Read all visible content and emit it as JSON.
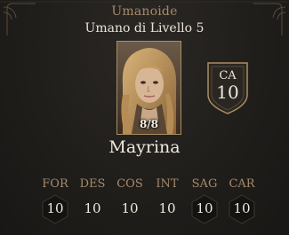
{
  "character": {
    "race": "Umanoide",
    "subrace": "Umano di Livello 5",
    "name": "Mayrina",
    "hp": "8/8"
  },
  "armor_class": {
    "label": "CA",
    "value": "10"
  },
  "abilities": [
    {
      "label": "FOR",
      "value": "10"
    },
    {
      "label": "DES",
      "value": "10"
    },
    {
      "label": "COS",
      "value": "10"
    },
    {
      "label": "INT",
      "value": "10"
    },
    {
      "label": "SAG",
      "value": "10"
    },
    {
      "label": "CAR",
      "value": "10"
    }
  ],
  "colors": {
    "accent_gold": "#a78a6b",
    "text_light": "#efe9df",
    "background": "#201e1b"
  }
}
